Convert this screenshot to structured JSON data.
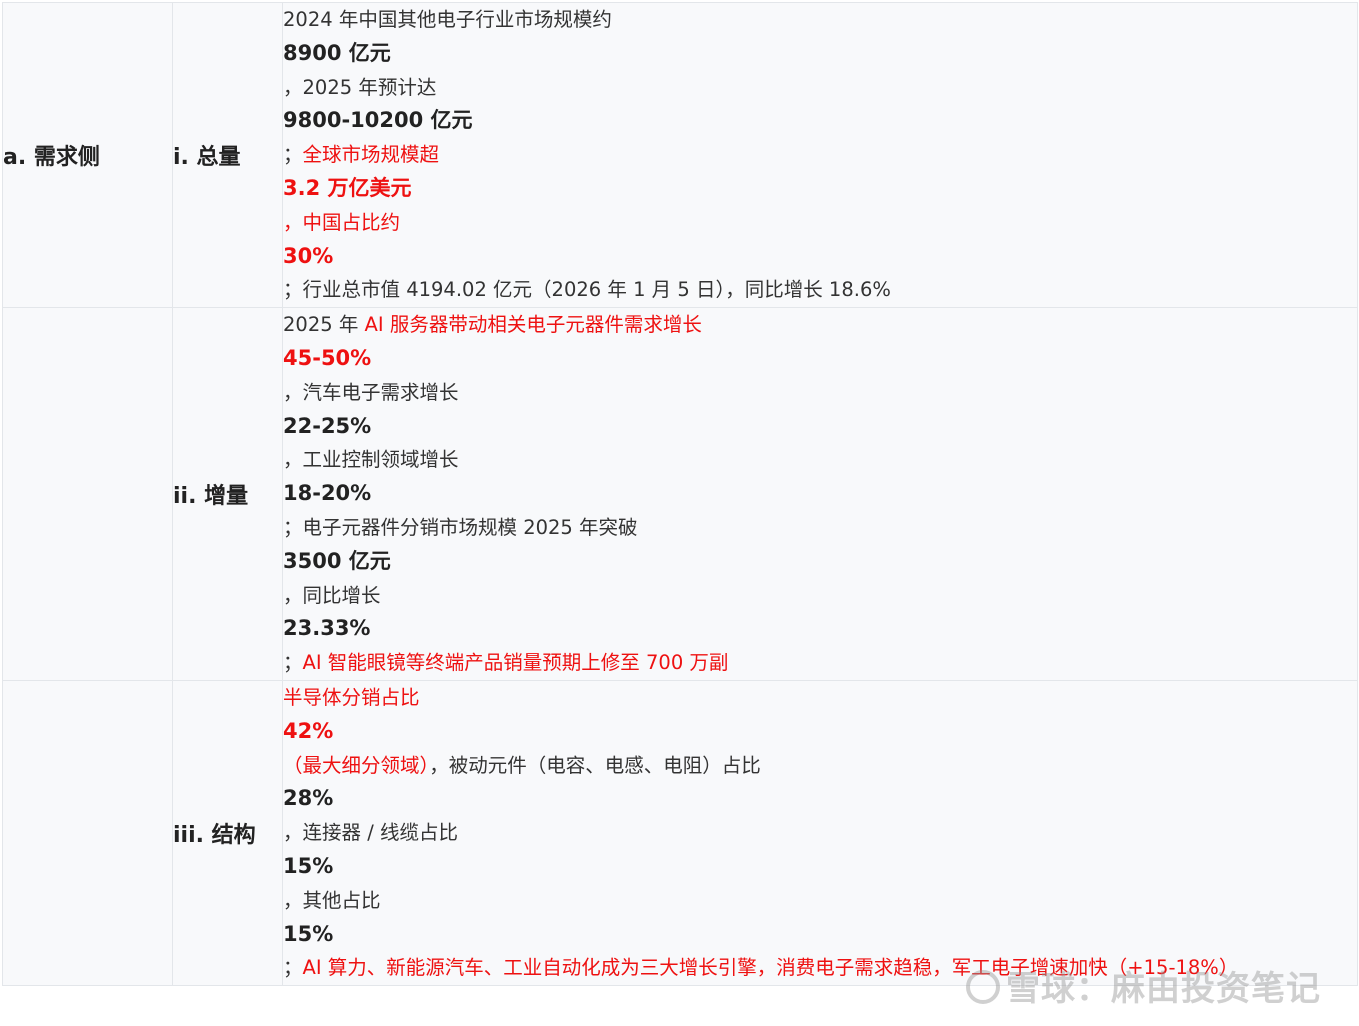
{
  "rows": [
    {
      "category": "a. 需求侧",
      "sub": "i. 总量",
      "lines": [
        {
          "segs": [
            {
              "t": "2024 年中国其他电子行业市场规模约"
            }
          ]
        },
        {
          "bold": true,
          "segs": [
            {
              "t": "8900 亿元"
            }
          ]
        },
        {
          "segs": [
            {
              "t": "，"
            },
            {
              "t": "2025 年预计达"
            }
          ]
        },
        {
          "bold": true,
          "segs": [
            {
              "t": "9800-10200 亿元"
            }
          ]
        },
        {
          "segs": [
            {
              "t": "；"
            },
            {
              "t": "全球市场规模超",
              "red": true
            }
          ]
        },
        {
          "bold": true,
          "segs": [
            {
              "t": "3.2 万亿美元",
              "red": true
            }
          ]
        },
        {
          "segs": [
            {
              "t": "，",
              "red": true
            },
            {
              "t": "中国占比约",
              "red": true
            }
          ]
        },
        {
          "bold": true,
          "segs": [
            {
              "t": "30%",
              "red": true
            }
          ]
        },
        {
          "segs": [
            {
              "t": "；"
            },
            {
              "t": "行业总市值 4194.02 亿元（2026 年 1 月 5 日），同比增长 18.6%"
            }
          ]
        }
      ]
    },
    {
      "category": "",
      "sub": "ii. 增量",
      "lines": [
        {
          "segs": [
            {
              "t": "2025 年 "
            },
            {
              "t": "AI 服务器带动相关电子元器件需求增长",
              "red": true
            }
          ]
        },
        {
          "bold": true,
          "segs": [
            {
              "t": "45-50%",
              "red": true
            }
          ]
        },
        {
          "segs": [
            {
              "t": "，"
            },
            {
              "t": "汽车电子需求增长"
            }
          ]
        },
        {
          "bold": true,
          "segs": [
            {
              "t": "22-25%"
            }
          ]
        },
        {
          "segs": [
            {
              "t": "，"
            },
            {
              "t": "工业控制领域增长"
            }
          ]
        },
        {
          "bold": true,
          "segs": [
            {
              "t": "18-20%"
            }
          ]
        },
        {
          "segs": [
            {
              "t": "；"
            },
            {
              "t": "电子元器件分销市场规模 2025 年突破"
            }
          ]
        },
        {
          "bold": true,
          "segs": [
            {
              "t": "3500 亿元"
            }
          ]
        },
        {
          "segs": [
            {
              "t": "，"
            },
            {
              "t": "同比增长"
            }
          ]
        },
        {
          "bold": true,
          "segs": [
            {
              "t": "23.33%"
            }
          ]
        },
        {
          "segs": [
            {
              "t": "；"
            },
            {
              "t": "AI 智能眼镜等终端产品销量预期上修至 700 万副",
              "red": true
            }
          ]
        }
      ]
    },
    {
      "category": "",
      "sub": "iii. 结构",
      "lines": [
        {
          "segs": [
            {
              "t": "半导体分销占比",
              "red": true
            }
          ]
        },
        {
          "bold": true,
          "segs": [
            {
              "t": "42%",
              "red": true
            }
          ]
        },
        {
          "segs": [
            {
              "t": "（最大细分领域）",
              "red": true
            },
            {
              "t": "，被动元件（电容、电感、电阻）占比"
            }
          ]
        },
        {
          "bold": true,
          "segs": [
            {
              "t": "28%"
            }
          ]
        },
        {
          "segs": [
            {
              "t": "，"
            },
            {
              "t": "连接器 / 线缆占比"
            }
          ]
        },
        {
          "bold": true,
          "segs": [
            {
              "t": "15%"
            }
          ]
        },
        {
          "segs": [
            {
              "t": "，"
            },
            {
              "t": "其他占比"
            }
          ]
        },
        {
          "bold": true,
          "segs": [
            {
              "t": "15%"
            }
          ]
        },
        {
          "segs": [
            {
              "t": "；"
            },
            {
              "t": "AI 算力、新能源汽车、工业自动化成为三大增长引擎，消费电子需求趋稳，军工电子增速加快（+15-18%）",
              "red": true
            }
          ]
        }
      ]
    }
  ],
  "watermark": "雪球：麻由投资笔记",
  "colors": {
    "red": "#ee1111",
    "text": "#333333",
    "border": "#e3e6ea",
    "background": "#f8f9fb"
  }
}
